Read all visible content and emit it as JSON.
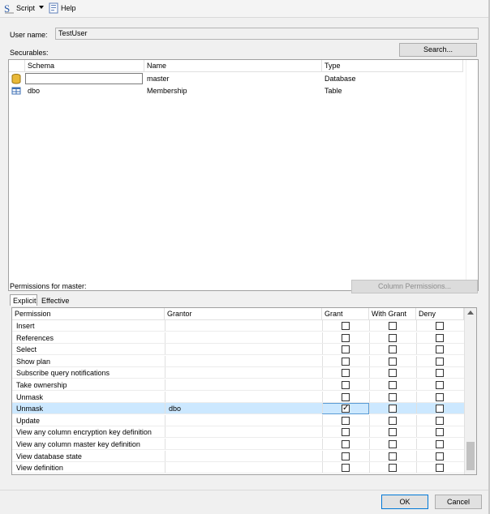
{
  "toolbar": {
    "script_label": "Script",
    "help_label": "Help"
  },
  "user_name": {
    "label": "User name:",
    "value": "TestUser"
  },
  "securables": {
    "label": "Securables:",
    "search_label": "Search...",
    "columns": [
      "",
      "Schema",
      "Name",
      "Type"
    ],
    "rows": [
      {
        "icon": "database-icon",
        "schema": "",
        "name": "master",
        "type": "Database"
      },
      {
        "icon": "table-icon",
        "schema": "dbo",
        "name": "Membership",
        "type": "Table"
      }
    ]
  },
  "permissions": {
    "label": "Permissions for master:",
    "column_permissions_label": "Column Permissions...",
    "tabs": [
      "Explicit",
      "Effective"
    ],
    "columns": [
      "Permission",
      "Grantor",
      "Grant",
      "With Grant",
      "Deny"
    ],
    "rows": [
      {
        "permission": "Insert",
        "grantor": "",
        "grant": false,
        "with_grant": false,
        "deny": false
      },
      {
        "permission": "References",
        "grantor": "",
        "grant": false,
        "with_grant": false,
        "deny": false
      },
      {
        "permission": "Select",
        "grantor": "",
        "grant": false,
        "with_grant": false,
        "deny": false
      },
      {
        "permission": "Show plan",
        "grantor": "",
        "grant": false,
        "with_grant": false,
        "deny": false
      },
      {
        "permission": "Subscribe query notifications",
        "grantor": "",
        "grant": false,
        "with_grant": false,
        "deny": false
      },
      {
        "permission": "Take ownership",
        "grantor": "",
        "grant": false,
        "with_grant": false,
        "deny": false
      },
      {
        "permission": "Unmask",
        "grantor": "",
        "grant": false,
        "with_grant": false,
        "deny": false
      },
      {
        "permission": "Unmask",
        "grantor": "dbo",
        "grant": true,
        "with_grant": false,
        "deny": false
      },
      {
        "permission": "Update",
        "grantor": "",
        "grant": false,
        "with_grant": false,
        "deny": false
      },
      {
        "permission": "View any column encryption key definition",
        "grantor": "",
        "grant": false,
        "with_grant": false,
        "deny": false
      },
      {
        "permission": "View any column master key definition",
        "grantor": "",
        "grant": false,
        "with_grant": false,
        "deny": false
      },
      {
        "permission": "View database state",
        "grantor": "",
        "grant": false,
        "with_grant": false,
        "deny": false
      },
      {
        "permission": "View definition",
        "grantor": "",
        "grant": false,
        "with_grant": false,
        "deny": false
      }
    ]
  },
  "buttons": {
    "ok_label": "OK",
    "cancel_label": "Cancel"
  },
  "colors": {
    "selection": "#cce8ff",
    "accent": "#5a9bd5"
  }
}
